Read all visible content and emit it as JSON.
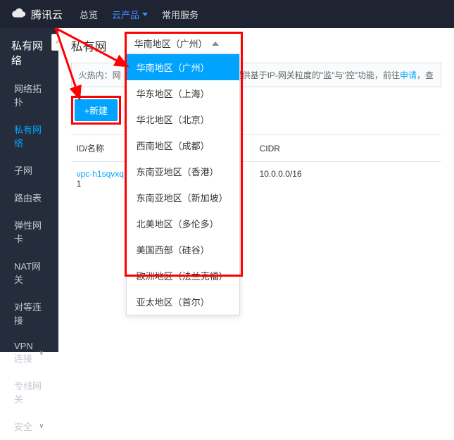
{
  "brand": "腾讯云",
  "topnav": {
    "overview": "总览",
    "products": "云产品",
    "services": "常用服务"
  },
  "sidebar": {
    "title": "私有网络",
    "items": [
      "网络拓扑",
      "私有网络",
      "子网",
      "路由表",
      "弹性网卡",
      "NAT网关",
      "对等连接",
      "VPN连接",
      "专线网关",
      "安全"
    ]
  },
  "activeSideIndex": 1,
  "page": {
    "title": "私有网",
    "callout_prefix": "火热内",
    "callout_mid": "：网",
    "callout_tail": "提供基于IP-网关粒度的\"监\"与\"控\"功能，前往",
    "callout_link": "申请",
    "callout_end": "，查",
    "new_btn": "+新建"
  },
  "region": {
    "trigger": "华南地区（广州）",
    "options": [
      "华南地区（广州）",
      "华东地区（上海）",
      "华北地区（北京）",
      "西南地区（成都）",
      "东南亚地区（香港）",
      "东南亚地区（新加坡）",
      "北美地区（多伦多）",
      "美国西部（硅谷）",
      "欧洲地区（法兰克福）",
      "亚太地区（首尔）"
    ],
    "selectedIndex": 0
  },
  "table": {
    "headers": {
      "id": "ID/名称",
      "cidr": "CIDR"
    },
    "row": {
      "id": "vpc-h1sqvxq",
      "idx": "1",
      "cidr": "10.0.0.0/16"
    }
  }
}
